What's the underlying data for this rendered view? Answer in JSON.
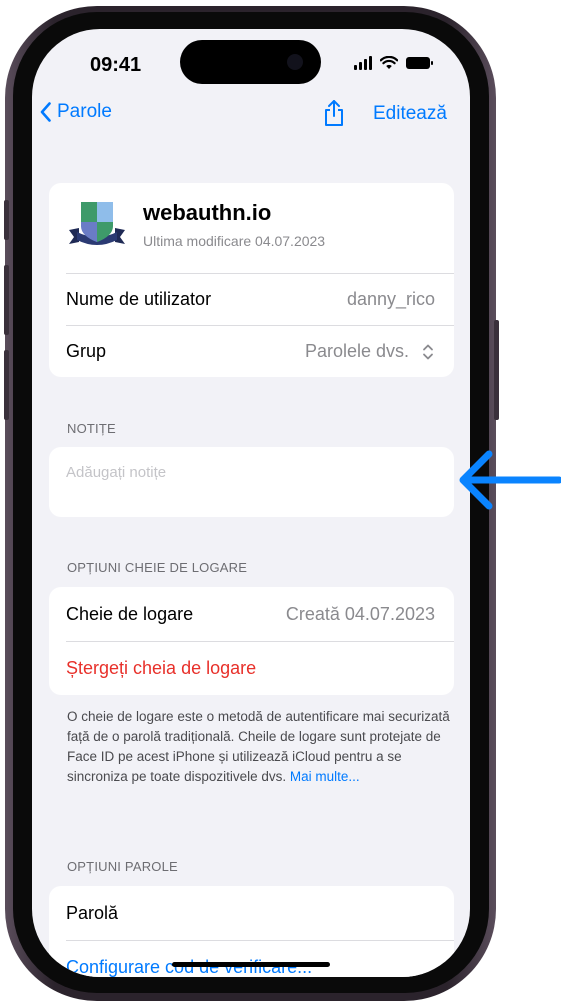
{
  "status_bar": {
    "time": "09:41"
  },
  "nav": {
    "back_label": "Parole",
    "edit_label": "Editează"
  },
  "site": {
    "name": "webauthn.io",
    "modified": "Ultima modificare 04.07.2023"
  },
  "details": [
    {
      "label": "Nume de utilizator",
      "value": "danny_rico"
    },
    {
      "label": "Grup",
      "value": "Parolele dvs."
    }
  ],
  "notes": {
    "header": "NOTIȚE",
    "placeholder": "Adăugați notițe"
  },
  "passkey": {
    "header": "OPȚIUNI CHEIE DE LOGARE",
    "label": "Cheie de logare",
    "value": "Creată 04.07.2023",
    "delete_label": "Ștergeți cheia de logare",
    "footer": "O cheie de logare este o metodă de autentificare mai securizată față de o parolă tradițională. Cheile de logare sunt protejate de Face ID pe acest iPhone și utilizează iCloud pentru a se sincroniza pe toate dispozitivele dvs.",
    "more_link": "Mai multe..."
  },
  "password_options": {
    "header": "OPȚIUNI PAROLE",
    "password_label": "Parolă",
    "verification_label": "Configurare cod de verificare..."
  },
  "colors": {
    "accent": "#007aff",
    "destructive": "#e8302a",
    "background": "#f2f2f7",
    "pointer_arrow": "#0a84ff"
  }
}
